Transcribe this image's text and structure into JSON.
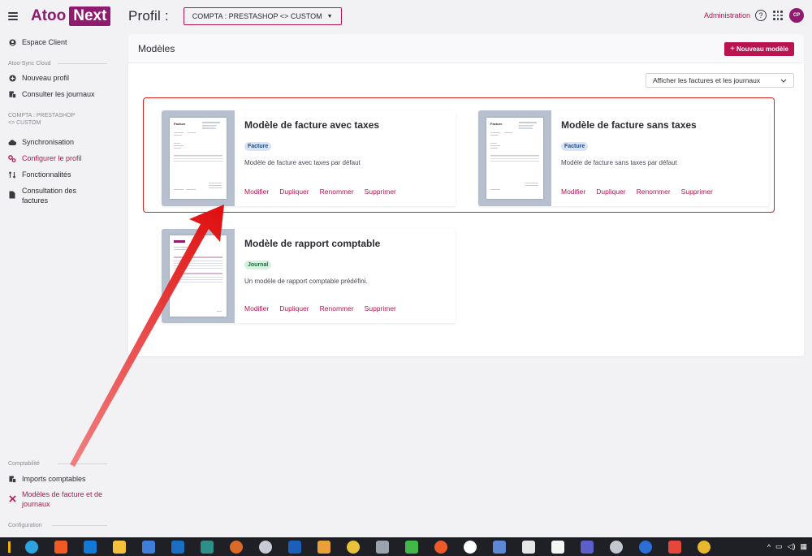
{
  "brand": {
    "name": "Atoo",
    "suffix": "Next"
  },
  "topbar": {
    "title": "Profil :",
    "profile_select": "COMPTA : PRESTASHOP <> CUSTOM",
    "admin": "Administration",
    "help": "?",
    "avatar": "CP"
  },
  "sidebar": {
    "espace_client": "Espace Client",
    "section_cloud": "Atoo-Sync Cloud",
    "nouveau_profil": "Nouveau profil",
    "consulter_journaux": "Consulter les journaux",
    "section_profile": "COMPTA : PRESTASHOP <> CUSTOM",
    "synchronisation": "Synchronisation",
    "configurer_profil": "Configurer le profil",
    "fonctionnalites": "Fonctionnalités",
    "consultation_factures": "Consultation des factures",
    "section_comptabilite": "Comptabilité",
    "imports_comptables": "Imports comptables",
    "modeles_facture": "Modèles de facture et de journaux",
    "section_configuration": "Configuration"
  },
  "panel": {
    "title": "Modèles",
    "new_button": "Nouveau modèle",
    "filter": "Afficher les factures et les journaux"
  },
  "cards": [
    {
      "title": "Modèle de facture avec taxes",
      "badge": "Facture",
      "description": "Modèle de facture avec taxes par défaut",
      "doc_title": "Facture"
    },
    {
      "title": "Modèle de facture sans taxes",
      "badge": "Facture",
      "description": "Modèle de facture sans taxes par défaut",
      "doc_title": "Facture"
    },
    {
      "title": "Modèle de rapport comptable",
      "badge": "Journal",
      "description": "Un modèle de rapport comptable prédéfini."
    }
  ],
  "actions": {
    "modifier": "Modifier",
    "dupliquer": "Dupliquer",
    "renommer": "Renommer",
    "supprimer": "Supprimer"
  },
  "taskbar_icons": [
    "edge-icon",
    "brave-icon",
    "outlook-icon",
    "explorer-icon",
    "store-icon",
    "calendar-icon",
    "notes-icon",
    "app-icon",
    "steam-icon",
    "mail-icon",
    "ftp-icon",
    "spark-icon",
    "printer-icon",
    "marker-icon",
    "pen-icon",
    "teamviewer-icon",
    "network-icon",
    "file-icon",
    "terminal-icon",
    "teams-icon",
    "chat-icon",
    "app2-icon",
    "powerpoint-icon",
    "chrome-icon"
  ],
  "colors": {
    "accent": "#b8144f",
    "brand": "#8e1b6e",
    "highlight": "#e02020"
  }
}
